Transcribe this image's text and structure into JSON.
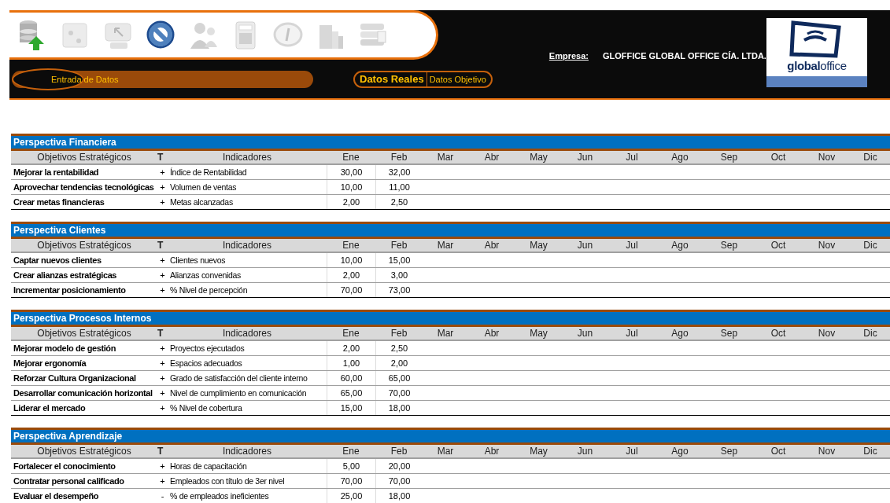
{
  "toolbar": [
    {
      "disabled": false
    },
    {
      "disabled": true
    },
    {
      "disabled": true
    },
    {
      "disabled": false
    },
    {
      "disabled": true
    },
    {
      "disabled": true
    },
    {
      "disabled": true
    },
    {
      "disabled": true
    },
    {
      "disabled": true
    }
  ],
  "nav": {
    "label": "Entrada de Datos"
  },
  "data_toggle": [
    {
      "label": "Datos Reales",
      "selected": true
    },
    {
      "label": "Datos Objetivo",
      "selected": false
    }
  ],
  "company": {
    "label": "Empresa:",
    "value": "GLOFFICE GLOBAL OFFICE CÍA. LTDA."
  },
  "logo": {
    "text": "**global**office"
  },
  "sections": [
    {
      "title": "Perspectiva Financiera",
      "columns": [
        "Objetivos Estratégicos",
        "T",
        "Indicadores",
        "Ene",
        "Feb",
        "Mar",
        "Abr",
        "May",
        "Jun",
        "Jul",
        "Ago",
        "Sep",
        "Oct",
        "Nov",
        "Dic"
      ],
      "rows": [
        {
          "objective": "Mejorar la rentabilidad",
          "sign": "+",
          "indicator": "Índice de Rentabilidad",
          "values": [
            "30,00",
            "32,00"
          ]
        },
        {
          "objective": "Aprovechar tendencias tecnológicas",
          "sign": "+",
          "indicator": "Volumen de ventas",
          "values": [
            "10,00",
            "11,00"
          ]
        },
        {
          "objective": "Crear metas financieras",
          "sign": "+",
          "indicator": "Metas alcanzadas",
          "values": [
            "2,00",
            "2,50"
          ]
        }
      ]
    },
    {
      "title": "Perspectiva Clientes",
      "columns": [
        "Objetivos Estratégicos",
        "T",
        "Indicadores",
        "Ene",
        "Feb",
        "Mar",
        "Abr",
        "May",
        "Jun",
        "Jul",
        "Ago",
        "Sep",
        "Oct",
        "Nov",
        "Dic"
      ],
      "rows": [
        {
          "objective": "Captar nuevos clientes",
          "sign": "+",
          "indicator": "Clientes nuevos",
          "values": [
            "10,00",
            "15,00"
          ]
        },
        {
          "objective": "Crear alianzas estratégicas",
          "sign": "+",
          "indicator": "Alianzas convenidas",
          "values": [
            "2,00",
            "3,00"
          ]
        },
        {
          "objective": "Incrementar posicionamiento",
          "sign": "+",
          "indicator": "% Nivel de percepción",
          "values": [
            "70,00",
            "73,00"
          ]
        }
      ]
    },
    {
      "title": "Perspectiva Procesos Internos",
      "columns": [
        "Objetivos Estratégicos",
        "T",
        "Indicadores",
        "Ene",
        "Feb",
        "Mar",
        "Abr",
        "May",
        "Jun",
        "Jul",
        "Ago",
        "Sep",
        "Oct",
        "Nov",
        "Dic"
      ],
      "rows": [
        {
          "objective": "Mejorar modelo de gestión",
          "sign": "+",
          "indicator": "Proyectos ejecutados",
          "values": [
            "2,00",
            "2,50"
          ]
        },
        {
          "objective": "Mejorar ergonomía",
          "sign": "+",
          "indicator": "Espacios adecuados",
          "values": [
            "1,00",
            "2,00"
          ]
        },
        {
          "objective": "Reforzar Cultura Organizacional",
          "sign": "+",
          "indicator": "Grado de satisfacción del cliente interno",
          "values": [
            "60,00",
            "65,00"
          ]
        },
        {
          "objective": "Desarrollar comunicación horizontal",
          "sign": "+",
          "indicator": "Nivel de cumplimiento en comunicación",
          "values": [
            "65,00",
            "70,00"
          ]
        },
        {
          "objective": "Liderar el mercado",
          "sign": "+",
          "indicator": "% Nivel de cobertura",
          "values": [
            "15,00",
            "18,00"
          ]
        }
      ]
    },
    {
      "title": "Perspectiva Aprendizaje",
      "columns": [
        "Objetivos Estratégicos",
        "T",
        "Indicadores",
        "Ene",
        "Feb",
        "Mar",
        "Abr",
        "May",
        "Jun",
        "Jul",
        "Ago",
        "Sep",
        "Oct",
        "Nov",
        "Dic"
      ],
      "rows": [
        {
          "objective": "Fortalecer el conocimiento",
          "sign": "+",
          "indicator": "Horas de capacitación",
          "values": [
            "5,00",
            "20,00"
          ]
        },
        {
          "objective": "Contratar personal calificado",
          "sign": "+",
          "indicator": "Empleados con título de 3er nivel",
          "values": [
            "70,00",
            "70,00"
          ]
        },
        {
          "objective": "Evaluar el desempeño",
          "sign": "-",
          "indicator": "% de empleados ineficientes",
          "values": [
            "25,00",
            "18,00"
          ]
        }
      ]
    }
  ]
}
